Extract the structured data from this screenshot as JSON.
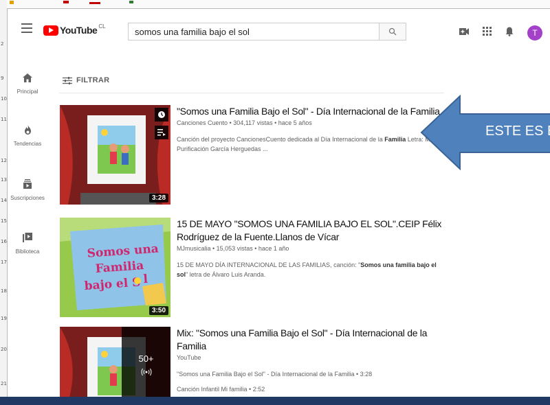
{
  "header": {
    "logo_text": "YouTube",
    "country_code": "CL",
    "search_value": "somos una familia bajo el sol",
    "avatar_letter": "T"
  },
  "sidebar": {
    "items": [
      {
        "label": "Principal",
        "icon": "home-icon"
      },
      {
        "label": "Tendencias",
        "icon": "flame-icon"
      },
      {
        "label": "Suscripciones",
        "icon": "subscriptions-icon"
      },
      {
        "label": "Biblioteca",
        "icon": "library-icon"
      }
    ]
  },
  "filter": {
    "label": "FILTRAR"
  },
  "results": [
    {
      "title": "\"Somos una Familia Bajo el Sol\" - Día Internacional de la Familia",
      "meta": "Canciones Cuento • 304,117 vistas • hace 5 años",
      "desc_parts": [
        "Canción del proyecto CancionesCuento dedicada al Día Internacional de la ",
        "Familia",
        " Letra: María Purificación García Herguedas ..."
      ],
      "duration": "3:28"
    },
    {
      "title": "15 DE MAYO \"SOMOS UNA FAMILIA BAJO EL SOL\".CEIP Félix Rodríguez de la Fuente.Llanos de Vícar",
      "meta": "MJmusicalia • 15,053 vistas • hace 1 año",
      "desc_parts": [
        "15 DE MAYO DÍA INTERNACIONAL DE LAS FAMILIAS, canción: \"",
        "Somos una familia bajo el sol",
        "\" letra de Álvaro Luis Aranda."
      ],
      "duration": "3:50",
      "thumb_text": [
        "Somos una",
        "Familia",
        "bajo el S",
        "l"
      ]
    },
    {
      "title": "Mix: \"Somos una Familia Bajo el Sol\" - Día Internacional de la Familia",
      "meta": "YouTube",
      "sub_items": [
        "\"Somos una Familia Bajo el Sol\" - Día Internacional de la Familia • 3:28",
        "Canción Infantil Mi familia • 2:52"
      ],
      "mix_count": "50+"
    }
  ],
  "annotation": {
    "text": "ESTE ES E",
    "color": "#4f81bd"
  },
  "ruler": [
    "2",
    "9",
    "10",
    "11",
    "12",
    "13",
    "14",
    "15",
    "16",
    "17",
    "18",
    "19",
    "20",
    "21"
  ]
}
